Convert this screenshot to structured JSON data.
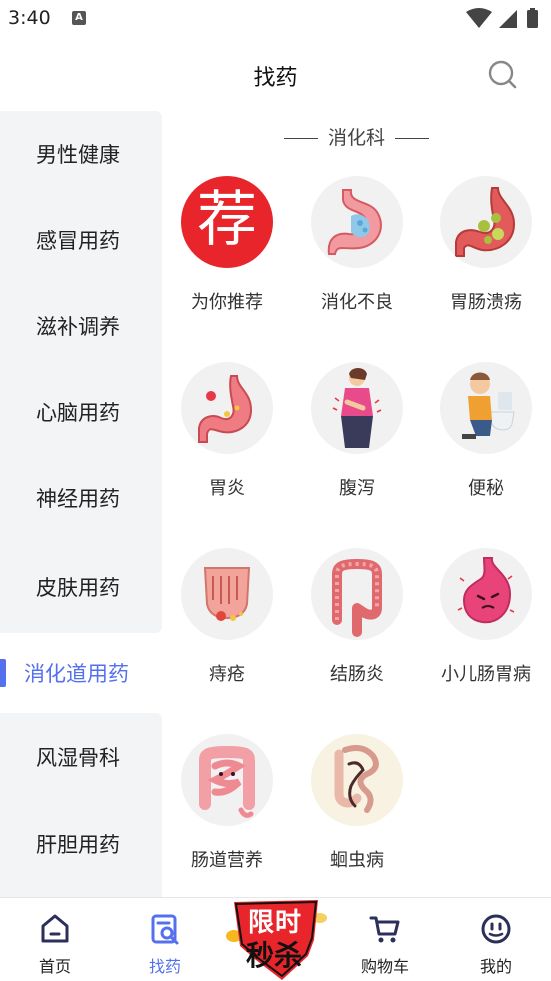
{
  "status": {
    "time": "3:40",
    "notif_icon": "A",
    "icons": [
      "wifi-icon",
      "signal-icon",
      "battery-icon"
    ]
  },
  "header": {
    "title": "找药",
    "search_icon": "search-icon"
  },
  "sidebar": {
    "items": [
      {
        "label": "男性健康"
      },
      {
        "label": "感冒用药"
      },
      {
        "label": "滋补调养"
      },
      {
        "label": "心脑用药"
      },
      {
        "label": "神经用药"
      },
      {
        "label": "皮肤用药"
      },
      {
        "label": "消化道用药",
        "active": true
      },
      {
        "label": "风湿骨科"
      },
      {
        "label": "肝胆用药"
      }
    ]
  },
  "content": {
    "section_title": "消化科",
    "items": [
      {
        "label": "为你推荐",
        "icon": "recommend-icon",
        "glyph": "荐"
      },
      {
        "label": "消化不良",
        "icon": "stomach-icon"
      },
      {
        "label": "胃肠溃疡",
        "icon": "ulcer-stomach-icon"
      },
      {
        "label": "胃炎",
        "icon": "gastritis-icon"
      },
      {
        "label": "腹泻",
        "icon": "diarrhea-icon"
      },
      {
        "label": "便秘",
        "icon": "constipation-icon"
      },
      {
        "label": "痔疮",
        "icon": "hemorrhoid-icon"
      },
      {
        "label": "结肠炎",
        "icon": "colon-icon"
      },
      {
        "label": "小儿肠胃病",
        "icon": "child-stomach-icon"
      },
      {
        "label": "肠道营养",
        "icon": "intestine-icon"
      },
      {
        "label": "蛔虫病",
        "icon": "worm-icon"
      }
    ]
  },
  "bottom_nav": {
    "items": [
      {
        "label": "首页",
        "icon": "home-icon"
      },
      {
        "label": "找药",
        "icon": "find-medicine-icon",
        "active": true
      },
      {
        "label": "购物车",
        "icon": "cart-icon"
      },
      {
        "label": "我的",
        "icon": "profile-icon"
      }
    ],
    "promo": {
      "line1": "限时",
      "line2": "秒杀"
    }
  },
  "colors": {
    "accent": "#5570ee",
    "sidebar_bg": "#f3f4f6",
    "promo_red": "#e8252b"
  }
}
